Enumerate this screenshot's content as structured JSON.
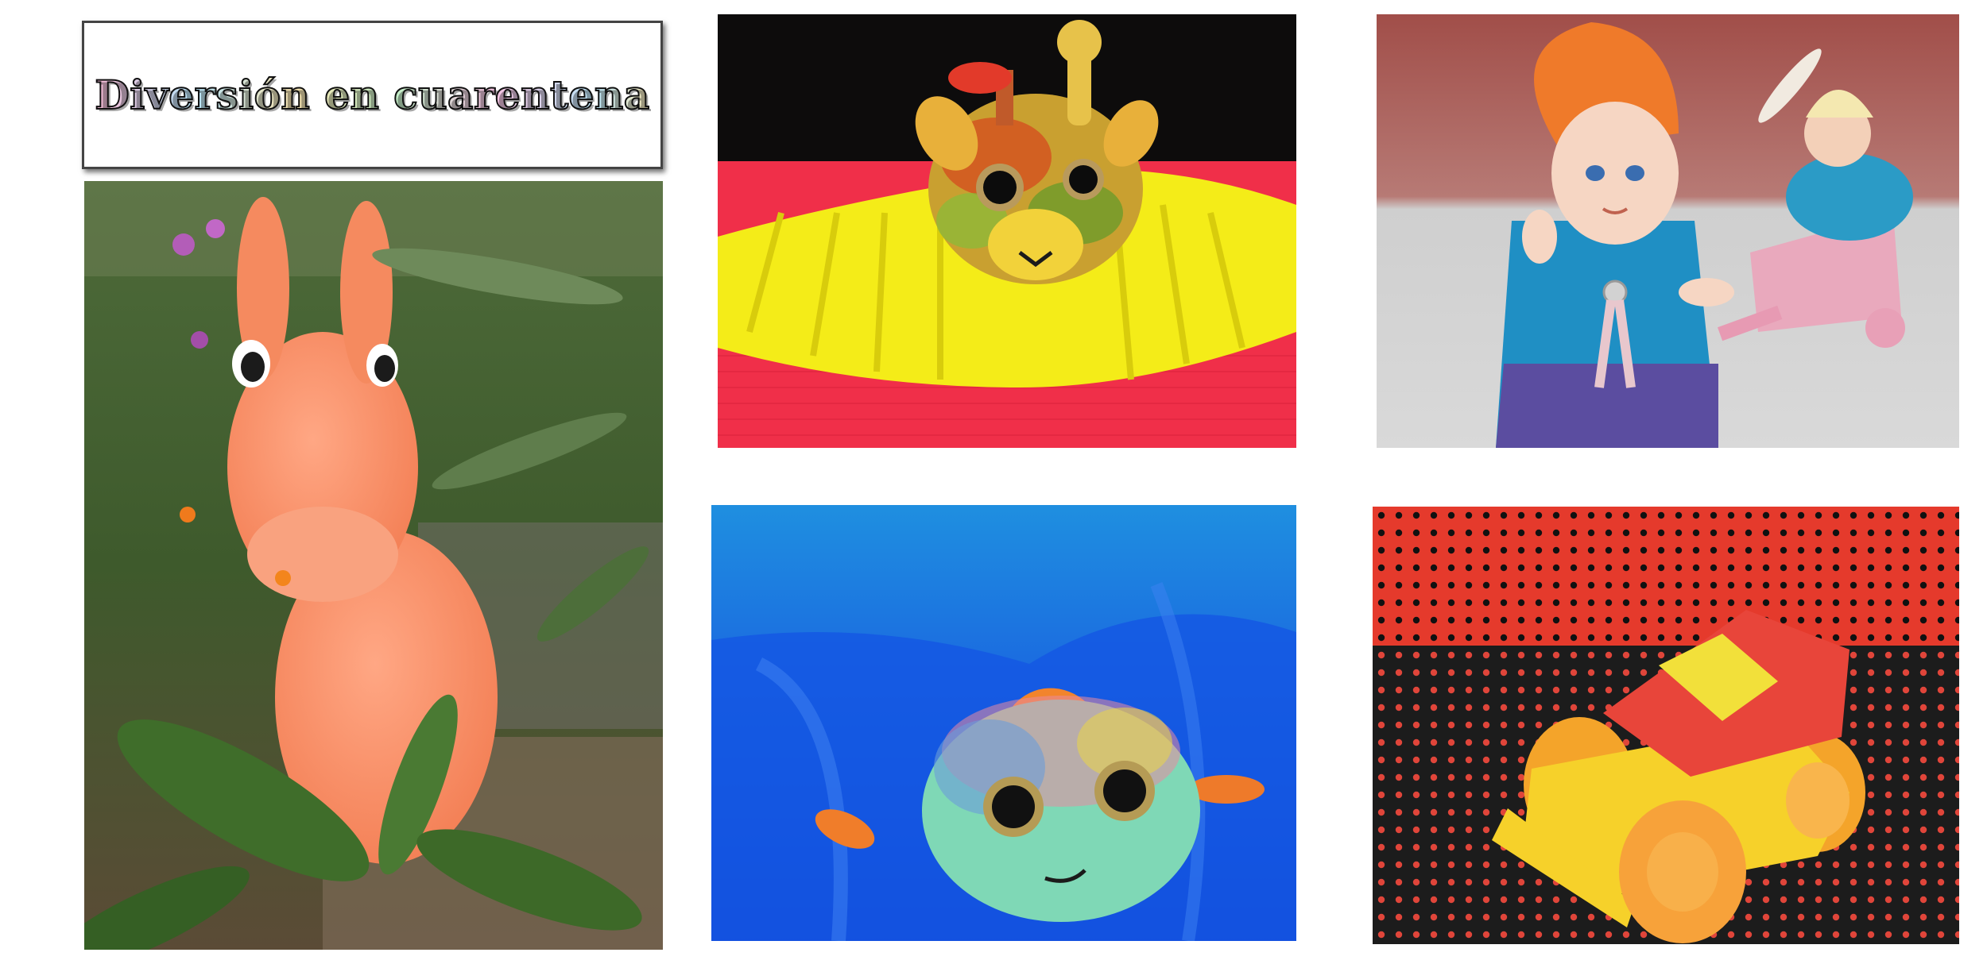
{
  "title": "Diversión en cuarentena",
  "photos": [
    {
      "name": "orange-horse-toy-photo",
      "subject": "orange inflatable hopper horse among plants"
    },
    {
      "name": "giraffe-plush-photo",
      "subject": "rainbow giraffe plush on yellow pipe cleaners"
    },
    {
      "name": "dolls-photo",
      "subject": "two small dolls with a pink cart"
    },
    {
      "name": "fish-plush-photo",
      "subject": "rainbow fish plush on blue cellophane"
    },
    {
      "name": "toy-car-photo",
      "subject": "yellow and red toy car on polka dot background"
    }
  ],
  "colors": {
    "background": "#ffffff",
    "title_border": "#444444"
  }
}
